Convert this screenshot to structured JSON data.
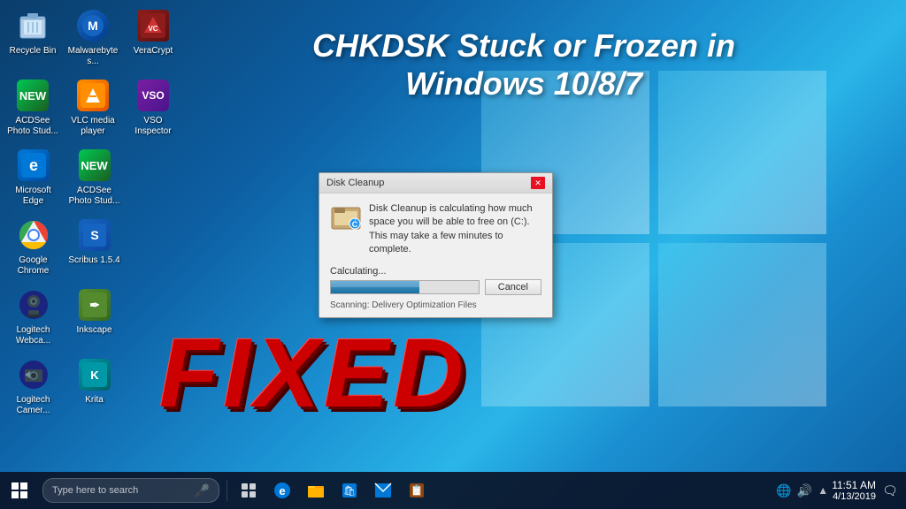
{
  "desktop": {
    "background": "Windows 10 desktop"
  },
  "heading": {
    "line1": "CHKDSK Stuck or Frozen in",
    "line2": "Windows 10/8/7"
  },
  "fixed_text": "FIXED",
  "icons": [
    {
      "id": "recycle-bin",
      "label": "Recycle Bin",
      "type": "recycle"
    },
    {
      "id": "malwarebytes",
      "label": "Malwarebytes...",
      "type": "malware"
    },
    {
      "id": "veracrypt",
      "label": "VeraCrypt",
      "type": "vera"
    },
    {
      "id": "acdsee-photo-studio",
      "label": "ACDSee\nPhoto Stud...",
      "type": "acdsee"
    },
    {
      "id": "vlc-media-player",
      "label": "VLC media\nplayer",
      "type": "vlc"
    },
    {
      "id": "vso-inspector",
      "label": "VSO\nInspector",
      "type": "vso"
    },
    {
      "id": "microsoft-edge",
      "label": "Microsoft\nEdge",
      "type": "edge"
    },
    {
      "id": "acdsee-photo-studio2",
      "label": "ACDSee\nPhoto Stud...",
      "type": "acdsee2"
    },
    {
      "id": "google-chrome",
      "label": "Google\nChrome",
      "type": "chrome"
    },
    {
      "id": "scribus",
      "label": "Scribus 1.5.4",
      "type": "scribus"
    },
    {
      "id": "logitech-webcam",
      "label": "Logitech\nWebca...",
      "type": "logitech"
    },
    {
      "id": "inkscape",
      "label": "Inkscape",
      "type": "inkscape"
    },
    {
      "id": "logitech-camera",
      "label": "Logitech\nCamer...",
      "type": "logitech2"
    },
    {
      "id": "krita",
      "label": "Krita",
      "type": "krita"
    }
  ],
  "dialog": {
    "title": "Disk Cleanup",
    "message": "Disk Cleanup is calculating how much space you will be able to free on  (C:). This may take a few minutes to complete.",
    "progress_label": "Calculating...",
    "progress_percent": 60,
    "cancel_button": "Cancel",
    "scanning_label": "Scanning:",
    "scanning_item": "Delivery Optimization Files"
  },
  "taskbar": {
    "search_placeholder": "Type here to search",
    "time": "11:51 AM",
    "date": "4/13/2019"
  }
}
